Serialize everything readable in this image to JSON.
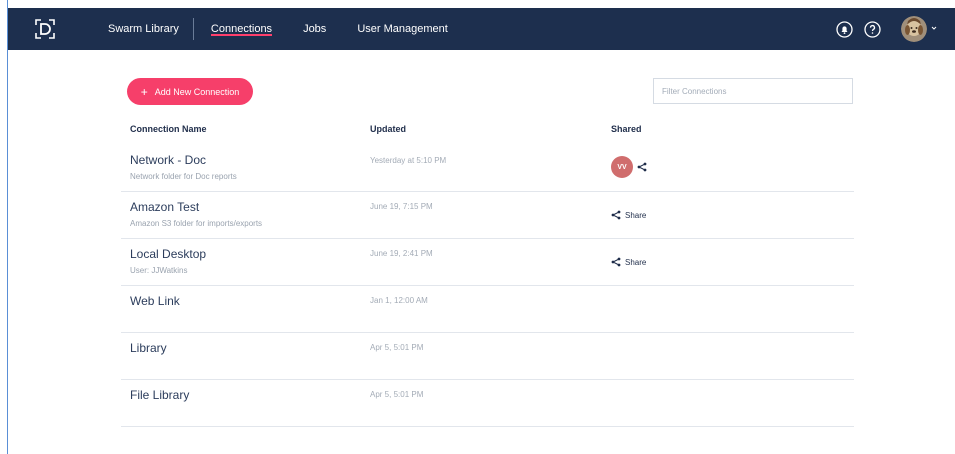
{
  "nav": {
    "items": [
      {
        "label": "Swarm Library"
      },
      {
        "label": "Connections"
      },
      {
        "label": "Jobs"
      },
      {
        "label": "User Management"
      }
    ],
    "active": "Connections"
  },
  "toolbar": {
    "add_label": "Add New Connection",
    "filter_placeholder": "Filter Connections"
  },
  "table": {
    "headers": {
      "name": "Connection Name",
      "updated": "Updated",
      "shared": "Shared"
    },
    "rows": [
      {
        "name": "Network - Doc",
        "desc": "Network folder for Doc reports",
        "updated": "Yesterday at 5:10 PM",
        "shared_initials": "VV"
      },
      {
        "name": "Amazon Test",
        "desc": "Amazon S3 folder for imports/exports",
        "updated": "June 19, 7:15 PM",
        "share_label": "Share"
      },
      {
        "name": "Local Desktop",
        "desc": "User: JJWatkins",
        "updated": "June 19, 2:41 PM",
        "share_label": "Share"
      },
      {
        "name": "Web Link",
        "updated": "Jan 1, 12:00 AM"
      },
      {
        "name": "Library",
        "updated": "Apr 5, 5:01 PM"
      },
      {
        "name": "File Library",
        "updated": "Apr 5, 5:01 PM"
      }
    ]
  },
  "colors": {
    "topbar": "#1d2f4e",
    "accent": "#f63f6a",
    "avatar_badge": "#d06d6d"
  },
  "icons": [
    "app-logo-icon",
    "notifications-icon",
    "help-icon",
    "user-avatar",
    "caret-down-icon",
    "plus-icon",
    "share-icon"
  ]
}
